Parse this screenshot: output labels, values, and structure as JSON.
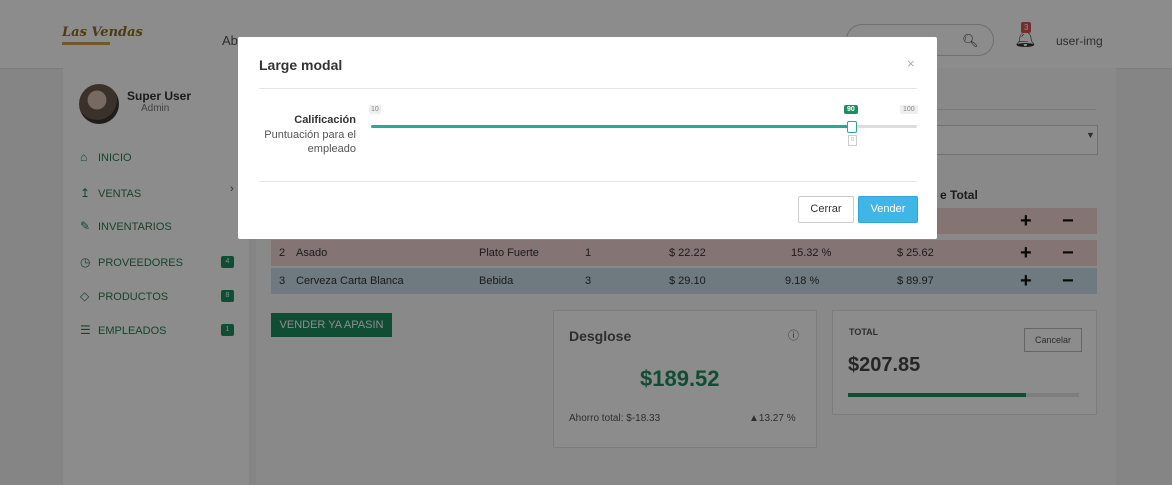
{
  "header": {
    "logo_text": "Las Vendas",
    "nav_partial": "Ab",
    "notification_count": "3",
    "user_label": "user-img"
  },
  "sidebar": {
    "user_name": "Super User",
    "user_role": "Admin",
    "items": [
      {
        "label": "INICIO",
        "icon": "home-icon"
      },
      {
        "label": "VENTAS",
        "icon": "sales-icon"
      },
      {
        "label": "INVENTARIOS",
        "icon": "edit-icon"
      },
      {
        "label": "PROVEEDORES",
        "icon": "clock-icon",
        "badge": "4"
      },
      {
        "label": "PRODUCTOS",
        "icon": "tag-icon",
        "badge": "8"
      },
      {
        "label": "EMPLEADOS",
        "icon": "list-icon",
        "badge": "1"
      }
    ]
  },
  "table": {
    "total_header": "e Total",
    "rows": [
      {
        "num": "2",
        "name": "Asado",
        "category": "Plato Fuerte",
        "qty": "1",
        "price": "$ 22.22",
        "pct": "15.32 %",
        "total": "$ 25.62"
      },
      {
        "num": "3",
        "name": "Cerveza Carta Blanca",
        "category": "Bebida",
        "qty": "3",
        "price": "$ 29.10",
        "pct": "9.18 %",
        "total": "$ 89.97"
      }
    ]
  },
  "sell_button": "VENDER YA APASIN",
  "breakdown": {
    "title": "Desglose",
    "amount": "$189.52",
    "savings": "Ahorro total: $-18.33",
    "savings_pct": "▲13.27 %"
  },
  "total_panel": {
    "label": "TOTAL",
    "amount": "$207.85",
    "cancel_label": "Cancelar",
    "progress": 0.77
  },
  "modal": {
    "title": "Large modal",
    "close": "×",
    "field_label": "Calificación",
    "field_desc_line1": "Puntuación para el",
    "field_desc_line2": "empleado",
    "slider_min": "10",
    "slider_max": "100",
    "slider_value": "90",
    "slider_tick": "0",
    "close_button": "Cerrar",
    "sell_button": "Vender"
  },
  "colors": {
    "brand_green": "#1c8e60",
    "slider_teal": "#29a89a",
    "primary_blue": "#3fb6e6"
  }
}
